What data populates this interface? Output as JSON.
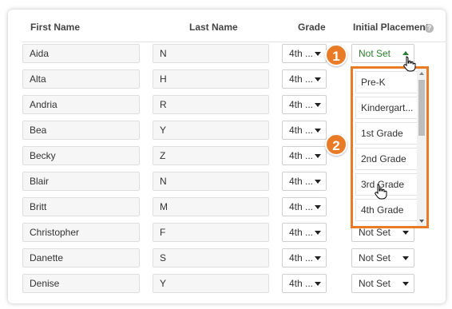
{
  "header": {
    "first_name": "First Name",
    "last_name": "Last Name",
    "grade": "Grade",
    "initial_placement": "Initial Placement",
    "help_glyph": "?"
  },
  "rows": [
    {
      "first": "Aida",
      "last": "N",
      "grade": "4th ...",
      "placement": "Not Set"
    },
    {
      "first": "Alta",
      "last": "H",
      "grade": "4th ..."
    },
    {
      "first": "Andria",
      "last": "R",
      "grade": "4th ..."
    },
    {
      "first": "Bea",
      "last": "Y",
      "grade": "4th ..."
    },
    {
      "first": "Becky",
      "last": "Z",
      "grade": "4th ..."
    },
    {
      "first": "Blair",
      "last": "N",
      "grade": "4th ..."
    },
    {
      "first": "Britt",
      "last": "M",
      "grade": "4th ..."
    },
    {
      "first": "Christopher",
      "last": "F",
      "grade": "4th ...",
      "placement": "Not Set"
    },
    {
      "first": "Danette",
      "last": "S",
      "grade": "4th ...",
      "placement": "Not Set"
    },
    {
      "first": "Denise",
      "last": "Y",
      "grade": "4th ...",
      "placement": "Not Set"
    }
  ],
  "dropdown": {
    "options": [
      "Pre-K",
      "Kindergart...",
      "1st Grade",
      "2nd Grade",
      "3rd Grade",
      "4th Grade"
    ]
  },
  "callouts": {
    "one": "1",
    "two": "2"
  },
  "colors": {
    "accent": "#ea7b26",
    "open_value": "#2e7d32"
  },
  "icons": {
    "help": "help-icon",
    "cursor": "hand-cursor-icon"
  }
}
